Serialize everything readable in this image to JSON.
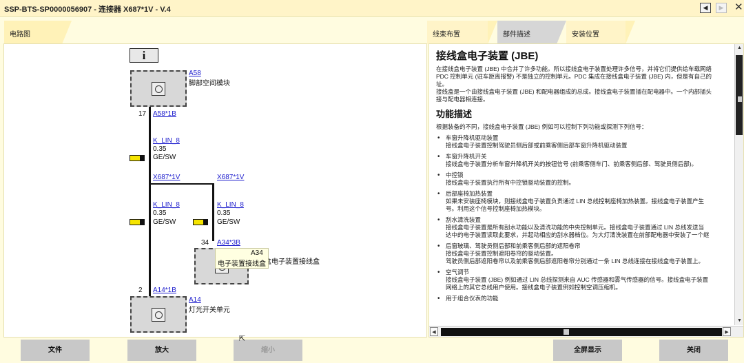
{
  "window": {
    "title": "SSP-BTS-SP0000056907 - 连接器 X687*1V - V.4",
    "controls": [
      "prev",
      "next",
      "close"
    ]
  },
  "left_tabs": [
    {
      "label": "电路图"
    }
  ],
  "right_tabs": [
    {
      "label": "线束布置"
    },
    {
      "label": "部件描述"
    },
    {
      "label": "安装位置"
    }
  ],
  "diagram": {
    "info_label": "i",
    "components": [
      {
        "id": "A58",
        "name": "脚部空间模块"
      },
      {
        "id": "A34",
        "name": "接线盒电子装置接线盒"
      },
      {
        "id": "A14",
        "name": "灯光开关单元"
      }
    ],
    "pins": [
      {
        "num": "17",
        "label": "A58*1B"
      },
      {
        "num": "34",
        "label": "A34*3B"
      },
      {
        "num": "2",
        "label": "A14*1B"
      }
    ],
    "connectors": [
      "X687*1V",
      "X687*1V"
    ],
    "wires": [
      {
        "name": "K_LIN_8",
        "size": "0.35",
        "color": "GE/SW"
      },
      {
        "name": "K_LIN_8",
        "size": "0.35",
        "color": "GE/SW"
      },
      {
        "name": "K_LIN_8",
        "size": "0.35",
        "color": "GE/SW"
      }
    ],
    "tooltip": {
      "title": "A34",
      "text": "电子装置接线盒"
    }
  },
  "doc": {
    "title": "接线盒电子装置 (JBE)",
    "intro": [
      "在接线盒电子装置 (JBE) 中合并了许多功能。所以接线盒电子装置处理许多信号，并将它们提供给车载网络",
      "PDC 控制单元 (驻车距离报警) 不是独立的控制单元。PDC 集成在接线盒电子装置 (JBE) 内，但是有自己的",
      "址。",
      "接线盒是一个由接线盒电子装置 (JBE) 和配电器组成的总成。接线盒电子装置插在配电器中。一个内部插头",
      "接与配电器相连接。"
    ],
    "section": "功能描述",
    "lead": "根据装备的不同，接线盒电子装置 (JBE) 例如可以控制下列功能或探测下列信号：",
    "items": [
      {
        "title": "车窗升降机驱动装置",
        "lines": [
          "接线盒电子装置控制驾驶员侧后部或前乘客侧后部车窗升降机驱动装置"
        ]
      },
      {
        "title": "车窗升降机开关",
        "lines": [
          "接线盒电子装置分析车窗升降机开关的按钮信号 (前乘客侧车门、前乘客侧后部、驾驶员侧后部)。"
        ]
      },
      {
        "title": "中控锁",
        "lines": [
          "接线盒电子装置执行所有中控锁驱动装置的控制。"
        ]
      },
      {
        "title": "后部座椅加热装置",
        "lines": [
          "如果未安装座椅模块，则接线盒电子装置负责通过 LIN 总线控制座椅加热装置。接线盒电子装置产生",
          "号。利用这个信号控制座椅加热模块。"
        ]
      },
      {
        "title": "刮水清洗装置",
        "lines": [
          "接线盒电子装置是所有刮水功能以及清洗功能的中央控制单元。接线盒电子装置通过 LIN 总线发送当",
          "达中的电子装置读取此要求，并起动相应的刮水器档位。为大灯清洗装置在前部配电器中安装了一个继"
        ]
      },
      {
        "title": "后窗玻璃、驾驶员侧后部和前乘客侧后部的遮阳卷帘",
        "lines": [
          "接线盒电子装置控制遮阳卷帘的驱动装置。",
          "驾驶员侧后部遮阳卷帘以及前乘客侧后部遮阳卷帘分别通过一条 LIN 总线连接在接线盒电子装置上。"
        ]
      },
      {
        "title": "空气调节",
        "lines": [
          "接线盒电子装置 (JBE) 例如通过 LIN 总线探测来自 AUC 传感器和雾气传感器的信号。接线盒电子装置",
          "网络上的其它总线用户使用。接线盒电子装置例如控制空调压缩机。"
        ]
      },
      {
        "title": "用于组合仪表的功能",
        "lines": []
      }
    ]
  },
  "buttons": {
    "file": "文件",
    "zoom_in": "放大",
    "zoom_out": "缩小",
    "fullscreen": "全屏显示",
    "close": "关闭"
  }
}
